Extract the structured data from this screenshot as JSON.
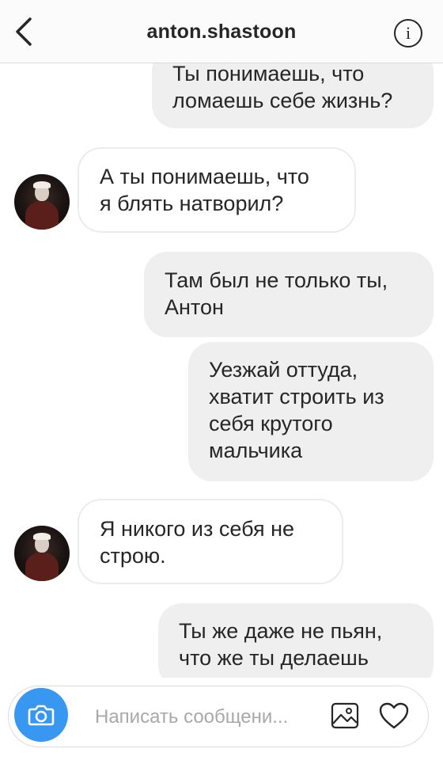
{
  "header": {
    "title": "anton.shastoon",
    "back_icon": "chevron-left-icon",
    "info_icon": "info-icon",
    "info_glyph": "i"
  },
  "messages": [
    {
      "direction": "outgoing",
      "lines": [
        "Ты понимаешь, что",
        "ломаешь себе жизнь?"
      ]
    },
    {
      "direction": "incoming",
      "lines": [
        "А ты понимаешь, что",
        "я блять натворил?"
      ]
    },
    {
      "direction": "outgoing",
      "lines": [
        "Там был не только ты,",
        "Антон"
      ]
    },
    {
      "direction": "outgoing",
      "lines": [
        "Уезжай оттуда,",
        "хватит строить из",
        "себя крутого",
        "мальчика"
      ]
    },
    {
      "direction": "incoming",
      "lines": [
        "Я никого из себя не",
        "строю."
      ]
    },
    {
      "direction": "outgoing",
      "lines": [
        "Ты же даже не пьян,",
        "что же ты делаешь"
      ]
    }
  ],
  "composer": {
    "placeholder": "Написать сообщени...",
    "camera_icon": "camera-icon",
    "gallery_icon": "image-gallery-icon",
    "like_icon": "heart-icon"
  },
  "colors": {
    "accent": "#3897f0",
    "outgoing_bubble": "#efefef",
    "incoming_border": "#ececec",
    "text": "#262626",
    "placeholder": "#a8a8a8"
  }
}
